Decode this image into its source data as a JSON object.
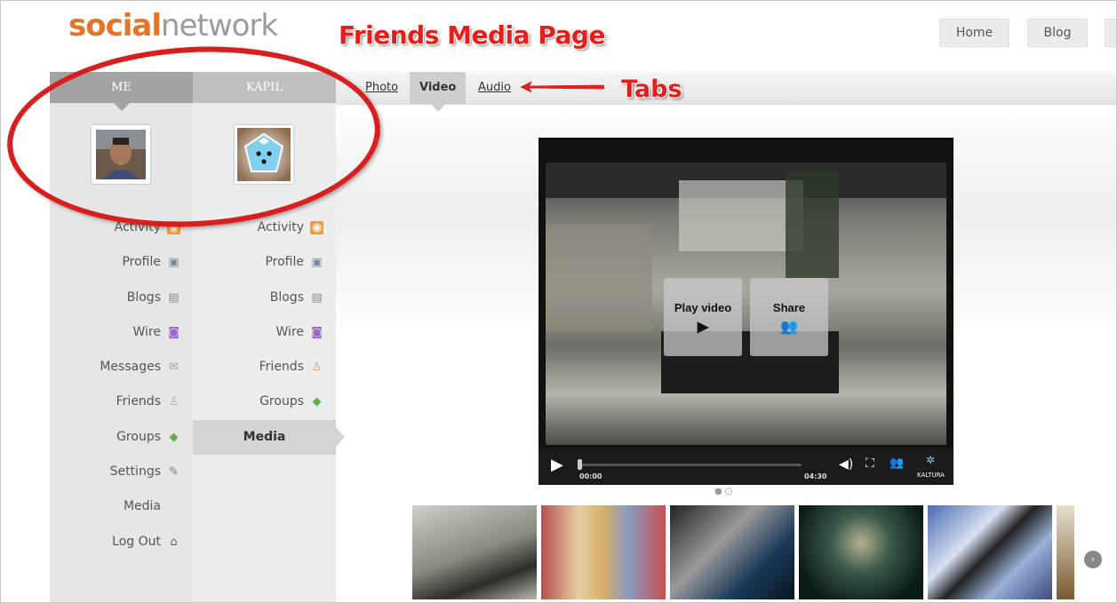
{
  "header": {
    "logo_part1": "social",
    "logo_part2": "network",
    "annotation_title": "Friends Media Page",
    "nav": [
      "Home",
      "Blog"
    ]
  },
  "tabs": {
    "items": [
      "Photo",
      "Video",
      "Audio"
    ],
    "active": "Video",
    "annotation": "Tabs"
  },
  "me_column": {
    "heading": "ME",
    "menu": [
      "Activity",
      "Profile",
      "Blogs",
      "Wire",
      "Messages",
      "Friends",
      "Groups",
      "Settings",
      "Media",
      "Log Out"
    ]
  },
  "friend_column": {
    "heading": "KAPIL",
    "menu": [
      "Activity",
      "Profile",
      "Blogs",
      "Wire",
      "Friends",
      "Groups",
      "Media"
    ],
    "active": "Media"
  },
  "video": {
    "play_label": "Play video",
    "share_label": "Share",
    "time_start": "00:00",
    "time_end": "04:30",
    "brand": "KALTURA"
  },
  "icons": {
    "activity": "rss-icon",
    "profile": "profile-icon",
    "blogs": "document-icon",
    "wire": "wire-icon",
    "messages": "envelope-icon",
    "friends": "person-icon",
    "groups": "cube-icon",
    "settings": "wrench-icon",
    "logout": "lock-icon"
  },
  "colors": {
    "annotation_red": "#e3201b",
    "logo_orange": "#e2752a"
  }
}
